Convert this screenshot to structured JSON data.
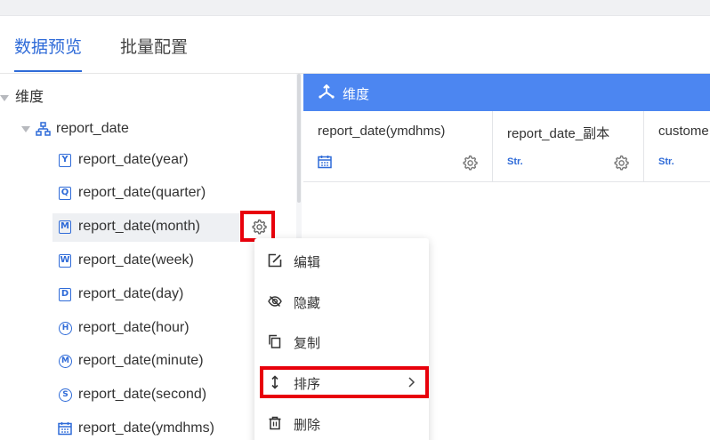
{
  "tabs": [
    {
      "label": "数据预览",
      "active": true
    },
    {
      "label": "批量配置",
      "active": false
    }
  ],
  "tree": {
    "root": {
      "label": "维度"
    },
    "group": {
      "label": "report_date"
    },
    "items": [
      {
        "label": "report_date(year)",
        "icon": "calendar-year-icon",
        "glyph": "Y"
      },
      {
        "label": "report_date(quarter)",
        "icon": "calendar-quarter-icon",
        "glyph": "Q"
      },
      {
        "label": "report_date(month)",
        "icon": "calendar-month-icon",
        "glyph": "M"
      },
      {
        "label": "report_date(week)",
        "icon": "calendar-week-icon",
        "glyph": "W"
      },
      {
        "label": "report_date(day)",
        "icon": "calendar-day-icon",
        "glyph": "D"
      },
      {
        "label": "report_date(hour)",
        "icon": "clock-hour-icon",
        "glyph": "H"
      },
      {
        "label": "report_date(minute)",
        "icon": "clock-minute-icon",
        "glyph": "M"
      },
      {
        "label": "report_date(second)",
        "icon": "clock-second-icon",
        "glyph": "S"
      },
      {
        "label": "report_date(ymdhms)",
        "icon": "calendar-icon",
        "glyph": ""
      }
    ]
  },
  "pane": {
    "title": "维度",
    "columns": [
      {
        "name": "report_date(ymdhms)",
        "type_icon": "calendar-icon"
      },
      {
        "name": "report_date_副本",
        "type_label": "Str."
      },
      {
        "name": "custome",
        "type_label": "Str."
      }
    ]
  },
  "context_menu": {
    "items": [
      {
        "label": "编辑",
        "icon": "edit-icon"
      },
      {
        "label": "隐藏",
        "icon": "eye-off-icon"
      },
      {
        "label": "复制",
        "icon": "copy-icon"
      },
      {
        "label": "排序",
        "icon": "sort-icon",
        "has_submenu": true
      },
      {
        "label": "删除",
        "icon": "trash-icon"
      }
    ]
  },
  "colors": {
    "accent": "#2f6bd8",
    "header_bg": "#4c86f1",
    "highlight_box": "#e8000b"
  }
}
